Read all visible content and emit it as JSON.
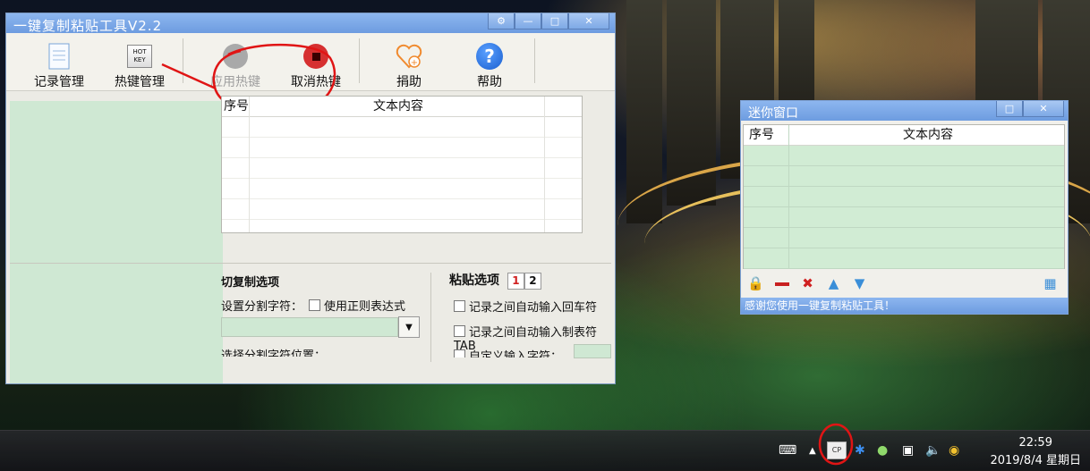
{
  "main_window": {
    "title": "一键复制粘贴工具V2.2",
    "controls": {
      "settings": "⚙",
      "minimize": "—",
      "maximize": "□",
      "close": "✕"
    },
    "toolbar": {
      "record_manage": "记录管理",
      "hotkey_manage": "热键管理",
      "hotkey_icon_text": "HOT KEY",
      "apply_hotkey": "应用热键",
      "cancel_hotkey": "取消热键",
      "donate": "捐助",
      "help": "帮助"
    },
    "table": {
      "col_index": "序号",
      "col_text": "文本内容"
    },
    "copy_options": {
      "heading": "切复制选项",
      "separator_label": "设置分割字符：",
      "regex_label": "使用正则表达式",
      "split_pos_label": "选择分割字符位置："
    },
    "paste_options": {
      "heading": "粘贴选项",
      "tab1": "1",
      "tab2": "2",
      "auto_enter": "记录之间自动输入回车符",
      "auto_tab": "记录之间自动输入制表符TAB",
      "custom_input": "自定义输入字符："
    }
  },
  "mini_window": {
    "title": "迷你窗口",
    "controls": {
      "maximize": "□",
      "close": "✕"
    },
    "table": {
      "col_index": "序号",
      "col_text": "文本内容"
    },
    "status": "感谢您使用一键复制粘贴工具！"
  },
  "taskbar": {
    "time": "22:59",
    "date": "2019/8/4 星期日",
    "app_tray_text": "CP"
  },
  "colors": {
    "title_blue": "#6d9ce0",
    "annotation_red": "#e01515",
    "list_green": "#cfe8d3"
  }
}
